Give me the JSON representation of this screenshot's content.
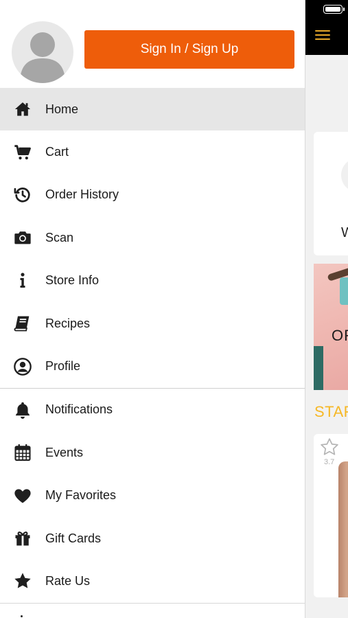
{
  "status_bar": {
    "battery_icon": "battery-icon"
  },
  "header": {
    "menu_icon": "hamburger-icon",
    "accent_color": "#e8a92a"
  },
  "drawer": {
    "avatar_icon": "avatar-placeholder-icon",
    "signin_label": "Sign In / Sign Up",
    "signin_color": "#ee5d0a",
    "items": [
      {
        "id": "home",
        "label": "Home",
        "icon": "home-icon",
        "active": true
      },
      {
        "id": "cart",
        "label": "Cart",
        "icon": "cart-icon"
      },
      {
        "id": "order-history",
        "label": "Order History",
        "icon": "history-icon"
      },
      {
        "id": "scan",
        "label": "Scan",
        "icon": "camera-icon"
      },
      {
        "id": "store-info",
        "label": "Store Info",
        "icon": "info-icon"
      },
      {
        "id": "recipes",
        "label": "Recipes",
        "icon": "book-icon"
      },
      {
        "id": "profile",
        "label": "Profile",
        "icon": "user-circle-icon"
      }
    ],
    "items2": [
      {
        "id": "notifications",
        "label": "Notifications",
        "icon": "bell-icon"
      },
      {
        "id": "events",
        "label": "Events",
        "icon": "calendar-icon"
      },
      {
        "id": "my-favorites",
        "label": "My Favorites",
        "icon": "heart-icon"
      },
      {
        "id": "gift-cards",
        "label": "Gift Cards",
        "icon": "gift-icon"
      },
      {
        "id": "rate-us",
        "label": "Rate Us",
        "icon": "star-icon"
      }
    ]
  },
  "main": {
    "welcome_text": "W",
    "banner_text": "OR",
    "section_title": "STAF",
    "product_rating": "3.7",
    "section_title_color": "#f6b826"
  }
}
